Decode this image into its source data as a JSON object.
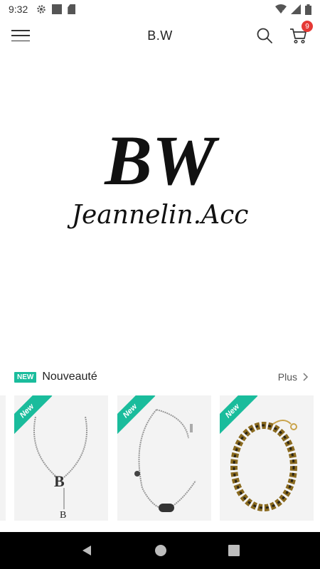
{
  "status_bar": {
    "time": "9:32",
    "left_icons": [
      "settings-icon",
      "notification-square-icon",
      "sd-card-icon"
    ],
    "right_icons": [
      "wifi-icon",
      "signal-icon",
      "battery-icon"
    ]
  },
  "app_bar": {
    "title": "B.W",
    "cart_count": "9"
  },
  "banner": {
    "logo_primary": "BW",
    "logo_secondary": "Jeannelin.Acc"
  },
  "section": {
    "tag": "NEW",
    "title": "Nouveauté",
    "more_label": "Plus"
  },
  "products": [
    {
      "ribbon": "New",
      "kind": "necklace-b-pendant"
    },
    {
      "ribbon": "New",
      "kind": "necklace-clasp"
    },
    {
      "ribbon": "New",
      "kind": "chain-bracelet"
    }
  ],
  "colors": {
    "accent": "#1abc9c",
    "badge": "#e53935",
    "nav_bar": "#000000"
  }
}
